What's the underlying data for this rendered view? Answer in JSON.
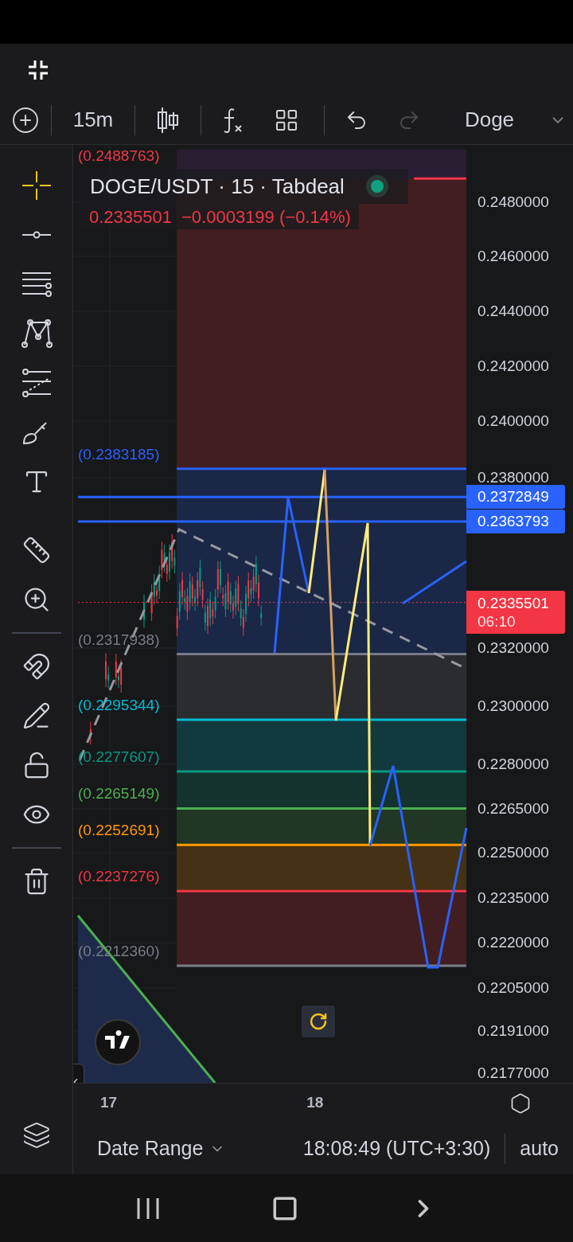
{
  "toolbar": {
    "interval": "15m",
    "symbol": "Doge",
    "redo_enabled": false
  },
  "tool_groups": [
    [
      {
        "kind": "crosshair",
        "selected": true
      },
      {
        "kind": "trend-line",
        "selected": false
      },
      {
        "kind": "fib",
        "selected": false
      },
      {
        "kind": "pattern",
        "selected": false
      },
      {
        "kind": "gann",
        "selected": false
      },
      {
        "kind": "brush",
        "selected": false
      },
      {
        "kind": "text",
        "selected": false
      }
    ],
    [
      {
        "kind": "ruler",
        "selected": false
      },
      {
        "kind": "zoom",
        "selected": false
      }
    ],
    [
      {
        "kind": "magnet",
        "selected": false
      },
      {
        "kind": "lock-drawing",
        "selected": false
      },
      {
        "kind": "lock",
        "selected": false
      },
      {
        "kind": "eye",
        "selected": false
      }
    ],
    [
      {
        "kind": "trash",
        "selected": false
      }
    ]
  ],
  "legend": {
    "title": "DOGE/USDT · 15 · Tabdeal",
    "price": "0.2335501",
    "change": "−0.0003199 (−0.14%)"
  },
  "fib_levels": [
    {
      "label": "(0.2488763)",
      "color": "#f23645"
    },
    {
      "label": "(0.2383185)",
      "color": "#2962ff"
    },
    {
      "label": "(0.2317938)",
      "color": "#787b86"
    },
    {
      "label": "(0.2295344)",
      "color": "#00bcd4"
    },
    {
      "label": "(0.2277607)",
      "color": "#089981"
    },
    {
      "label": "(0.2265149)",
      "color": "#4caf50"
    },
    {
      "label": "(0.2252691)",
      "color": "#ff9800"
    },
    {
      "label": "(0.2237276)",
      "color": "#f23645"
    },
    {
      "label": "(0.2212360)",
      "color": "#787b86"
    }
  ],
  "price_axis": {
    "ticks": [
      "0.2480000",
      "0.2460000",
      "0.2440000",
      "0.2420000",
      "0.2400000",
      "0.2380000",
      "0.2320000",
      "0.2300000",
      "0.2280000",
      "0.2265000",
      "0.2250000",
      "0.2235000",
      "0.2220000",
      "0.2205000",
      "0.2191000",
      "0.2177000"
    ],
    "markers": [
      {
        "kind": "line",
        "price": "0.2372849"
      },
      {
        "kind": "line",
        "price": "0.2363793"
      },
      {
        "kind": "last",
        "price": "0.2335501",
        "countdown": "06:10"
      }
    ]
  },
  "time_axis": [
    "17",
    "18"
  ],
  "footer": {
    "range": "Date Range",
    "clock": "18:08:49 (UTC+3:30)",
    "scale": "auto"
  }
}
